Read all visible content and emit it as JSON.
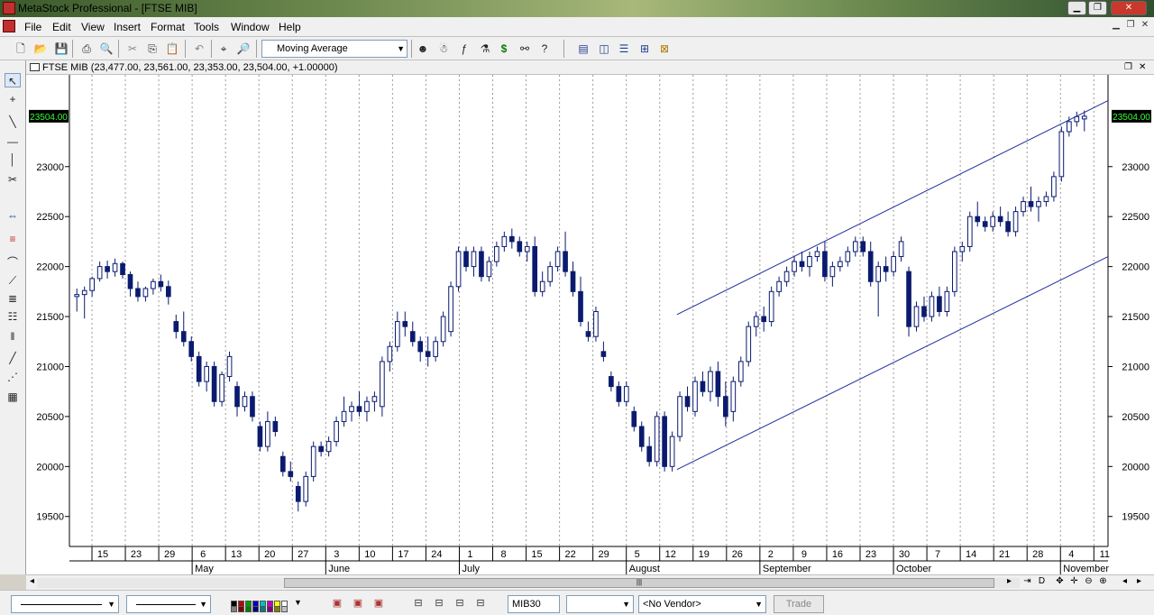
{
  "window": {
    "title": "MetaStock Professional - [FTSE MIB]"
  },
  "menu": [
    "File",
    "Edit",
    "View",
    "Insert",
    "Format",
    "Tools",
    "Window",
    "Help"
  ],
  "toolbar": {
    "indicator_select": "Moving Average"
  },
  "chart_window": {
    "title": "FTSE MIB (23,477.00, 23,561.00, 23,353.00, 23,504.00, +1.00000)",
    "last_price_label": "23504.00"
  },
  "chart_data": {
    "type": "candlestick",
    "security": "FTSE MIB",
    "last": {
      "open": 23477.0,
      "high": 23561.0,
      "low": 23353.0,
      "close": 23504.0,
      "change": 1.0
    },
    "ylim": [
      19200,
      23900
    ],
    "y_ticks": [
      19500,
      20000,
      20500,
      21000,
      21500,
      22000,
      22500,
      23000
    ],
    "y_tick_labels": [
      "19500",
      "20000",
      "20500",
      "21000",
      "21500",
      "22000",
      "22500",
      "23000"
    ],
    "grid": "vertical dotted",
    "day_labels": [
      "15",
      "23",
      "29",
      "6",
      "13",
      "20",
      "27",
      "3",
      "10",
      "17",
      "24",
      "1",
      "8",
      "15",
      "22",
      "29",
      "5",
      "12",
      "19",
      "26",
      "2",
      "9",
      "16",
      "23",
      "30",
      "7",
      "14",
      "21",
      "28",
      "4",
      "11"
    ],
    "month_labels": [
      "May",
      "June",
      "July",
      "August",
      "September",
      "October",
      "November"
    ],
    "channel": {
      "upper": [
        [
          0.585,
          21520
        ],
        [
          1.0,
          23660
        ]
      ],
      "lower": [
        [
          0.585,
          19970
        ],
        [
          1.0,
          22100
        ]
      ]
    },
    "candles": [
      [
        21700,
        21780,
        21550,
        21720
      ],
      [
        21720,
        21800,
        21480,
        21760
      ],
      [
        21760,
        21900,
        21700,
        21880
      ],
      [
        21880,
        22050,
        21850,
        22000
      ],
      [
        22000,
        22060,
        21880,
        21950
      ],
      [
        21950,
        22080,
        21900,
        22030
      ],
      [
        22030,
        22050,
        21880,
        21920
      ],
      [
        21920,
        21950,
        21700,
        21780
      ],
      [
        21780,
        21850,
        21650,
        21700
      ],
      [
        21700,
        21800,
        21650,
        21780
      ],
      [
        21780,
        21880,
        21720,
        21850
      ],
      [
        21850,
        21920,
        21750,
        21800
      ],
      [
        21800,
        21860,
        21620,
        21700
      ],
      [
        21450,
        21520,
        21280,
        21350
      ],
      [
        21350,
        21550,
        21200,
        21250
      ],
      [
        21250,
        21300,
        21050,
        21100
      ],
      [
        21100,
        21150,
        20800,
        20850
      ],
      [
        20850,
        21050,
        20750,
        21000
      ],
      [
        21000,
        21050,
        20600,
        20650
      ],
      [
        20650,
        20950,
        20600,
        20920
      ],
      [
        20900,
        21150,
        20850,
        21100
      ],
      [
        20800,
        20850,
        20500,
        20600
      ],
      [
        20600,
        20750,
        20550,
        20700
      ],
      [
        20700,
        20750,
        20450,
        20500
      ],
      [
        20400,
        20450,
        20150,
        20200
      ],
      [
        20200,
        20550,
        20150,
        20450
      ],
      [
        20450,
        20500,
        20300,
        20350
      ],
      [
        20100,
        20150,
        19900,
        19950
      ],
      [
        19950,
        20050,
        19850,
        19900
      ],
      [
        19800,
        19850,
        19550,
        19650
      ],
      [
        19650,
        19950,
        19600,
        19900
      ],
      [
        19900,
        20250,
        19850,
        20200
      ],
      [
        20200,
        20250,
        20100,
        20150
      ],
      [
        20150,
        20300,
        20100,
        20250
      ],
      [
        20250,
        20500,
        20200,
        20450
      ],
      [
        20450,
        20700,
        20400,
        20550
      ],
      [
        20550,
        20650,
        20450,
        20600
      ],
      [
        20600,
        20750,
        20500,
        20550
      ],
      [
        20550,
        20700,
        20450,
        20650
      ],
      [
        20650,
        20750,
        20550,
        20700
      ],
      [
        20600,
        21100,
        20500,
        21050
      ],
      [
        21050,
        21250,
        20950,
        21200
      ],
      [
        21200,
        21550,
        21150,
        21450
      ],
      [
        21450,
        21550,
        21300,
        21400
      ],
      [
        21350,
        21450,
        21200,
        21250
      ],
      [
        21250,
        21300,
        21050,
        21150
      ],
      [
        21150,
        21300,
        21000,
        21100
      ],
      [
        21100,
        21300,
        21050,
        21250
      ],
      [
        21250,
        21550,
        21200,
        21500
      ],
      [
        21350,
        21850,
        21300,
        21800
      ],
      [
        21800,
        22200,
        21750,
        22150
      ],
      [
        22150,
        22200,
        21950,
        22000
      ],
      [
        22000,
        22200,
        21900,
        22150
      ],
      [
        22150,
        22200,
        21850,
        21900
      ],
      [
        21900,
        22100,
        21850,
        22050
      ],
      [
        22050,
        22250,
        22000,
        22200
      ],
      [
        22200,
        22350,
        22150,
        22300
      ],
      [
        22300,
        22380,
        22180,
        22250
      ],
      [
        22250,
        22300,
        22100,
        22150
      ],
      [
        22150,
        22250,
        22050,
        22200
      ],
      [
        22200,
        22300,
        21700,
        21750
      ],
      [
        21750,
        21950,
        21700,
        21850
      ],
      [
        21850,
        22050,
        21800,
        22000
      ],
      [
        22000,
        22200,
        21950,
        22150
      ],
      [
        22150,
        22350,
        21900,
        21950
      ],
      [
        21950,
        22050,
        21700,
        21750
      ],
      [
        21750,
        21900,
        21400,
        21450
      ],
      [
        21350,
        21450,
        21250,
        21300
      ],
      [
        21300,
        21600,
        21250,
        21550
      ],
      [
        21150,
        21250,
        21050,
        21100
      ],
      [
        20900,
        20950,
        20750,
        20800
      ],
      [
        20800,
        20850,
        20600,
        20650
      ],
      [
        20650,
        20850,
        20600,
        20800
      ],
      [
        20550,
        20600,
        20350,
        20400
      ],
      [
        20400,
        20450,
        20150,
        20200
      ],
      [
        20200,
        20300,
        20000,
        20050
      ],
      [
        20050,
        20550,
        20000,
        20500
      ],
      [
        20500,
        20550,
        19950,
        20000
      ],
      [
        20000,
        20350,
        19950,
        20300
      ],
      [
        20300,
        20750,
        20250,
        20700
      ],
      [
        20700,
        20800,
        20550,
        20600
      ],
      [
        20550,
        20900,
        20500,
        20850
      ],
      [
        20850,
        20950,
        20700,
        20750
      ],
      [
        20750,
        21000,
        20650,
        20950
      ],
      [
        20950,
        21050,
        20600,
        20700
      ],
      [
        20700,
        20850,
        20400,
        20500
      ],
      [
        20550,
        20900,
        20450,
        20850
      ],
      [
        20850,
        21100,
        20800,
        21050
      ],
      [
        21050,
        21450,
        21000,
        21400
      ],
      [
        21400,
        21550,
        21300,
        21500
      ],
      [
        21500,
        21600,
        21350,
        21450
      ],
      [
        21450,
        21800,
        21400,
        21750
      ],
      [
        21750,
        21900,
        21700,
        21850
      ],
      [
        21850,
        22000,
        21800,
        21950
      ],
      [
        21950,
        22100,
        21900,
        22050
      ],
      [
        22050,
        22150,
        21950,
        22000
      ],
      [
        22000,
        22150,
        21900,
        22100
      ],
      [
        22100,
        22200,
        22050,
        22150
      ],
      [
        22150,
        22250,
        21850,
        21900
      ],
      [
        21900,
        22050,
        21800,
        22000
      ],
      [
        22000,
        22100,
        21950,
        22050
      ],
      [
        22050,
        22200,
        22000,
        22150
      ],
      [
        22150,
        22300,
        22100,
        22250
      ],
      [
        22250,
        22300,
        22100,
        22150
      ],
      [
        22150,
        22250,
        21800,
        21850
      ],
      [
        21850,
        22050,
        21500,
        22000
      ],
      [
        22000,
        22100,
        21850,
        21950
      ],
      [
        21950,
        22150,
        21900,
        22100
      ],
      [
        22100,
        22300,
        22050,
        22250
      ],
      [
        21950,
        22000,
        21300,
        21400
      ],
      [
        21400,
        21650,
        21350,
        21600
      ],
      [
        21600,
        21700,
        21450,
        21500
      ],
      [
        21500,
        21750,
        21450,
        21700
      ],
      [
        21700,
        21800,
        21500,
        21550
      ],
      [
        21550,
        21800,
        21500,
        21750
      ],
      [
        21750,
        22200,
        21700,
        22150
      ],
      [
        22150,
        22250,
        22050,
        22200
      ],
      [
        22200,
        22550,
        22150,
        22500
      ],
      [
        22500,
        22650,
        22400,
        22450
      ],
      [
        22450,
        22500,
        22350,
        22400
      ],
      [
        22400,
        22550,
        22350,
        22500
      ],
      [
        22500,
        22600,
        22400,
        22450
      ],
      [
        22450,
        22550,
        22300,
        22350
      ],
      [
        22350,
        22600,
        22300,
        22550
      ],
      [
        22550,
        22700,
        22500,
        22650
      ],
      [
        22650,
        22800,
        22550,
        22600
      ],
      [
        22600,
        22700,
        22450,
        22650
      ],
      [
        22650,
        22750,
        22600,
        22700
      ],
      [
        22700,
        22950,
        22650,
        22900
      ],
      [
        22900,
        23400,
        22850,
        23350
      ],
      [
        23350,
        23500,
        23300,
        23450
      ],
      [
        23450,
        23550,
        23400,
        23500
      ],
      [
        23477,
        23561,
        23353,
        23504
      ]
    ]
  },
  "bottom": {
    "symbol_field": "MIB30",
    "vendor_select": "<No Vendor>",
    "trade_label": "Trade"
  },
  "colors": {
    "candle": "#0a1a6e",
    "channel": "#1f2f9f",
    "price_label_bg": "#000000",
    "price_label_fg": "#33ff33"
  }
}
